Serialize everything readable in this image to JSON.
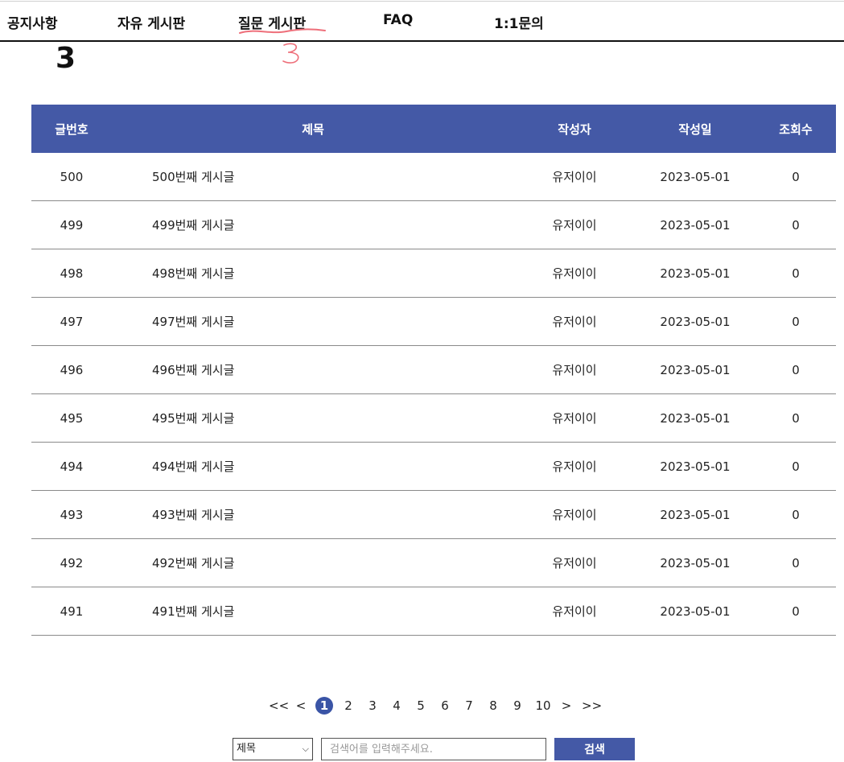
{
  "nav": {
    "items": [
      {
        "label": "공지사항"
      },
      {
        "label": "자유 게시판"
      },
      {
        "label": "질문 게시판"
      },
      {
        "label": "FAQ"
      },
      {
        "label": "1:1문의"
      }
    ],
    "annotation_mark": "3"
  },
  "page_number_heading": "3",
  "board": {
    "headers": [
      "글번호",
      "제목",
      "작성자",
      "작성일",
      "조회수"
    ],
    "rows": [
      {
        "no": "500",
        "title": "500번째 게시글",
        "author": "유저이이",
        "date": "2023-05-01",
        "views": "0"
      },
      {
        "no": "499",
        "title": "499번째 게시글",
        "author": "유저이이",
        "date": "2023-05-01",
        "views": "0"
      },
      {
        "no": "498",
        "title": "498번째 게시글",
        "author": "유저이이",
        "date": "2023-05-01",
        "views": "0"
      },
      {
        "no": "497",
        "title": "497번째 게시글",
        "author": "유저이이",
        "date": "2023-05-01",
        "views": "0"
      },
      {
        "no": "496",
        "title": "496번째 게시글",
        "author": "유저이이",
        "date": "2023-05-01",
        "views": "0"
      },
      {
        "no": "495",
        "title": "495번째 게시글",
        "author": "유저이이",
        "date": "2023-05-01",
        "views": "0"
      },
      {
        "no": "494",
        "title": "494번째 게시글",
        "author": "유저이이",
        "date": "2023-05-01",
        "views": "0"
      },
      {
        "no": "493",
        "title": "493번째 게시글",
        "author": "유저이이",
        "date": "2023-05-01",
        "views": "0"
      },
      {
        "no": "492",
        "title": "492번째 게시글",
        "author": "유저이이",
        "date": "2023-05-01",
        "views": "0"
      },
      {
        "no": "491",
        "title": "491번째 게시글",
        "author": "유저이이",
        "date": "2023-05-01",
        "views": "0"
      }
    ]
  },
  "pagination": {
    "first": "<<",
    "prev": "<",
    "pages": [
      "1",
      "2",
      "3",
      "4",
      "5",
      "6",
      "7",
      "8",
      "9",
      "10"
    ],
    "current": "1",
    "next": ">",
    "last": ">>"
  },
  "search": {
    "field_selected": "제목",
    "placeholder": "검색어를 입력해주세요.",
    "button_label": "검색"
  },
  "colors": {
    "header_bg": "#4459a6",
    "active_page": "#3a54a6",
    "annotation": "#ee6f7a"
  }
}
